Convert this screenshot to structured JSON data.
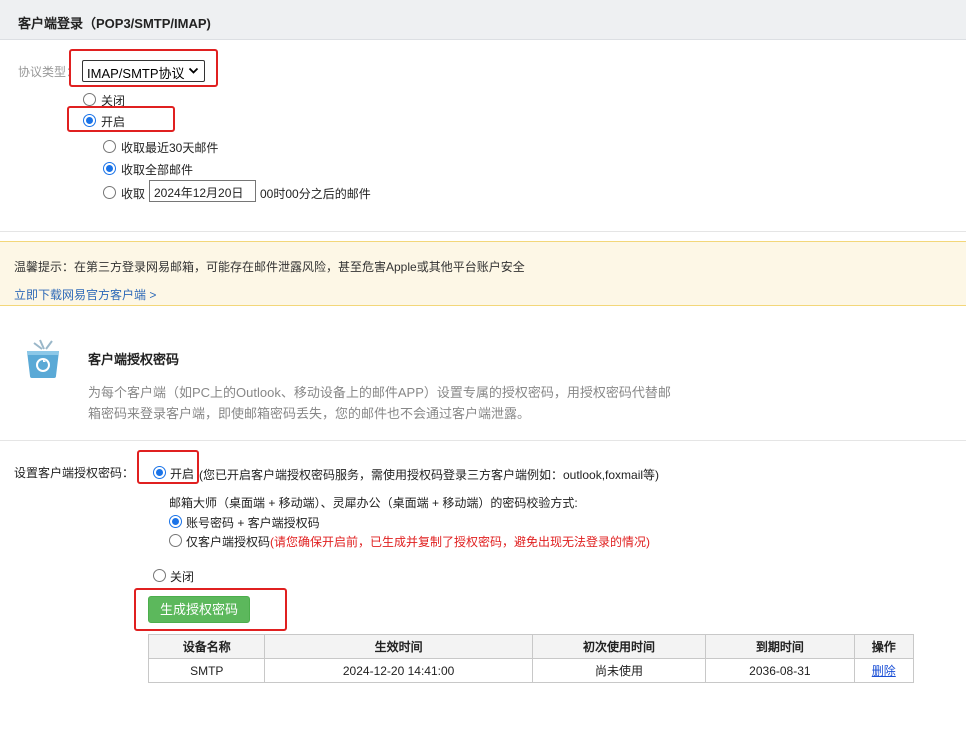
{
  "header": {
    "title": "客户端登录（POP3/SMTP/IMAP)"
  },
  "protocol": {
    "label": "协议类型：",
    "selected": "IMAP/SMTP协议",
    "options": [
      {
        "label": "关闭",
        "checked": false
      },
      {
        "label": "开启",
        "checked": true
      }
    ],
    "sub_options": [
      {
        "label": "收取最近30天邮件",
        "checked": false
      },
      {
        "label": "收取全部邮件",
        "checked": true
      },
      {
        "label_prefix": "收取",
        "date_value": "2024年12月20日",
        "label_suffix": "00时00分之后的邮件",
        "checked": false
      }
    ]
  },
  "tip": {
    "text": "温馨提示：在第三方登录网易邮箱，可能存在邮件泄露风险，甚至危害Apple或其他平台账户安全",
    "link": "立即下载网易官方客户端 >"
  },
  "auth": {
    "title": "客户端授权密码",
    "desc": "为每个客户端（如PC上的Outlook、移动设备上的邮件APP）设置专属的授权密码，用授权密码代替邮箱密码来登录客户端，即使邮箱密码丢失，您的邮件也不会通过客户端泄露。",
    "icon": "recycle-box-icon"
  },
  "setting": {
    "label": "设置客户端授权密码：",
    "on_label": "开启",
    "on_note": "(您已开启客户端授权密码服务，需使用授权码登录三方客户端例如：outlook,foxmail等)",
    "verify_title": "邮箱大师（桌面端 + 移动端）、灵犀办公（桌面端 + 移动端）的密码校验方式:",
    "verify_opt1": "账号密码 + 客户端授权码",
    "verify_opt2": "仅客户端授权码",
    "verify_opt2_note": "(请您确保开启前，已生成并复制了授权密码，避免出现无法登录的情况)",
    "off_label": "关闭",
    "generate_button": "生成授权密码"
  },
  "table": {
    "headers": [
      "设备名称",
      "生效时间",
      "初次使用时间",
      "到期时间",
      "操作"
    ],
    "rows": [
      {
        "device": "SMTP",
        "effective": "2024-12-20 14:41:00",
        "first_use": "尚未使用",
        "expires": "2036-08-31",
        "action": "删除"
      }
    ]
  },
  "colors": {
    "highlight": "#e02020",
    "button": "#5cb85c",
    "link": "#2e6ab8",
    "tip_bg": "#fdf7e6"
  }
}
